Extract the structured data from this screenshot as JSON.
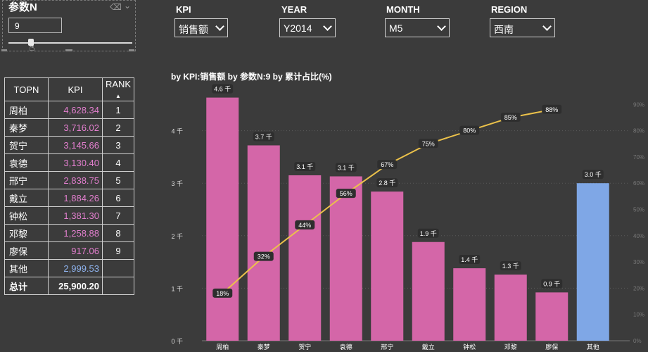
{
  "param": {
    "title": "参数N",
    "value": "9"
  },
  "filters": [
    {
      "label": "KPI",
      "value": "销售额"
    },
    {
      "label": "YEAR",
      "value": "Y2014"
    },
    {
      "label": "MONTH",
      "value": "M5"
    },
    {
      "label": "REGION",
      "value": "西南"
    }
  ],
  "table": {
    "headers": {
      "name": "TOPN",
      "kpi": "KPI",
      "rank": "RANK"
    },
    "rows": [
      {
        "name": "周柏",
        "kpi": "4,628.34",
        "rank": "1"
      },
      {
        "name": "秦梦",
        "kpi": "3,716.02",
        "rank": "2"
      },
      {
        "name": "贺宁",
        "kpi": "3,145.66",
        "rank": "3"
      },
      {
        "name": "袁德",
        "kpi": "3,130.40",
        "rank": "4"
      },
      {
        "name": "邢宁",
        "kpi": "2,838.75",
        "rank": "5"
      },
      {
        "name": "戴立",
        "kpi": "1,884.26",
        "rank": "6"
      },
      {
        "name": "钟松",
        "kpi": "1,381.30",
        "rank": "7"
      },
      {
        "name": "邓黎",
        "kpi": "1,258.88",
        "rank": "8"
      },
      {
        "name": "廖保",
        "kpi": "917.06",
        "rank": "9"
      },
      {
        "name": "其他",
        "kpi": "2,999.53",
        "rank": ""
      }
    ],
    "total": {
      "name": "总计",
      "kpi": "25,900.20",
      "rank": ""
    },
    "colors": {
      "top": "#e37fcf",
      "other": "#8fb4f0"
    }
  },
  "chart_data": {
    "type": "bar",
    "title": "by KPI:销售额 by 参数N:9 by 累计占比(%)",
    "categories": [
      "周柏",
      "秦梦",
      "贺宁",
      "袁德",
      "邢宁",
      "戴立",
      "钟松",
      "邓黎",
      "廖保",
      "其他"
    ],
    "series": [
      {
        "type": "bar",
        "values": [
          4.63,
          3.72,
          3.15,
          3.13,
          2.84,
          1.88,
          1.38,
          1.26,
          0.92,
          3.0
        ],
        "labels": [
          "4.6 千",
          "3.7 千",
          "3.1 千",
          "3.1 千",
          "2.8 千",
          "1.9 千",
          "1.4 千",
          "1.3 千",
          "0.9 千",
          "3.0 千"
        ],
        "colors": [
          "#d466a8",
          "#d466a8",
          "#d466a8",
          "#d466a8",
          "#d466a8",
          "#d466a8",
          "#d466a8",
          "#d466a8",
          "#d466a8",
          "#7fa7e6"
        ]
      },
      {
        "type": "line",
        "values": [
          18,
          32,
          44,
          56,
          67,
          75,
          80,
          85,
          88
        ],
        "labels": [
          "18%",
          "32%",
          "44%",
          "56%",
          "67%",
          "75%",
          "80%",
          "85%",
          "88%"
        ],
        "color": "#ecc24a"
      }
    ],
    "y_ticks": [
      "0 千",
      "1 千",
      "2 千",
      "3 千",
      "4 千"
    ],
    "ylim": [
      0,
      5
    ],
    "y2_ticks": [
      "0%",
      "10%",
      "20%",
      "30%",
      "40%",
      "50%",
      "60%",
      "70%",
      "80%",
      "90%"
    ],
    "y2lim": [
      0,
      100
    ],
    "grid": true
  }
}
